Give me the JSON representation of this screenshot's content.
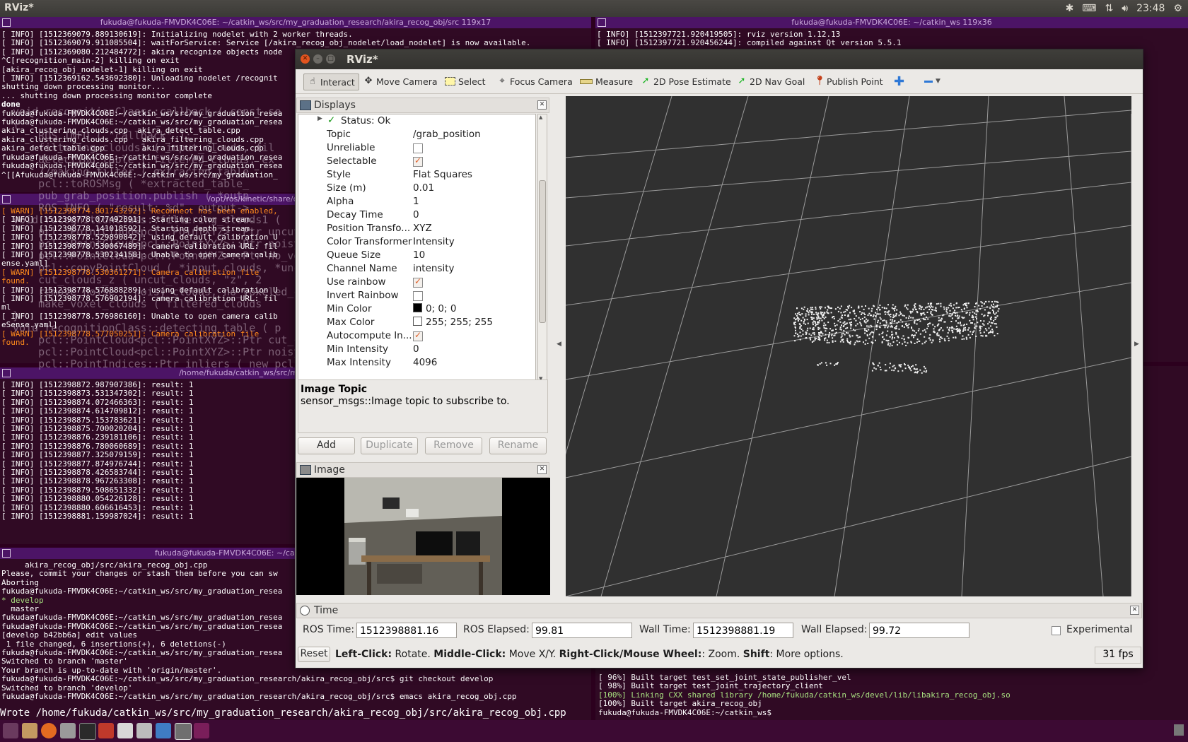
{
  "topbar": {
    "app_title": "RViz*",
    "clock": "23:48",
    "tray_icons": [
      "dropbox-icon",
      "keyboard-icon",
      "network-icon",
      "volume-icon"
    ]
  },
  "terminals": {
    "t1": {
      "title": "fukuda@fukuda-FMVDK4C06E: ~/catkin_ws/src/my_graduation_research/akira_recog_obj/src 119x17",
      "lines": [
        {
          "t": "[ INFO] [1512369079.889130619]: Initializing nodelet with 2 worker threads.",
          "c": ""
        },
        {
          "t": "[ INFO] [1512369079.911085504]: waitForService: Service [/akira_recog_obj_nodelet/load_nodelet] is now available.",
          "c": ""
        },
        {
          "t": "[ INFO] [1512369080.212484772]: akira recognize objects node",
          "c": ""
        },
        {
          "t": "^C[recognition_main-2] killing on exit",
          "c": ""
        },
        {
          "t": "[akira_recog_obj_nodelet-1] killing on exit",
          "c": ""
        },
        {
          "t": "[ INFO] [1512369162.543692380]: Unloading nodelet /recognit",
          "c": ""
        },
        {
          "t": "shutting down processing monitor...",
          "c": ""
        },
        {
          "t": "... shutting down processing monitor complete",
          "c": ""
        },
        {
          "t": "done",
          "c": "b"
        },
        {
          "t": "fukuda@fukuda-FMVDK4C06E:~/catkin_ws/src/my_graduation_resea",
          "c": ""
        },
        {
          "t": "fukuda@fukuda-FMVDK4C06E:~/catkin_ws/src/my_graduation_resea",
          "c": ""
        },
        {
          "t": "akira_clustering_clouds.cpp  akira_detect_table.cpp",
          "c": ""
        },
        {
          "t": "akira_clustering_clouds.cpp   akira_filtering_clouds.cpp",
          "c": ""
        },
        {
          "t": "akira_detect_table.cpp        akira_filtering_clouds.cpp",
          "c": ""
        },
        {
          "t": "fukuda@fukuda-FMVDK4C06E:~/catkin_ws/src/my_graduation_resea",
          "c": ""
        },
        {
          "t": "fukuda@fukuda-FMVDK4C06E:~/catkin_ws/src/my_graduation_resea",
          "c": ""
        },
        {
          "t": "^[[Afukuda@fukuda-FMVDK4C06E:~/catkin_ws/src/my_graduation_",
          "c": ""
        }
      ]
    },
    "t2": {
      "title": "fukuda@fukuda-FMVDK4C06E: ~/catkin_ws 119x36",
      "lines": [
        {
          "t": "[ INFO] [1512397721.920419505]: rviz version 1.12.13",
          "c": ""
        },
        {
          "t": "[ INFO] [1512397721.920456244]: compiled against Qt version 5.5.1",
          "c": ""
        }
      ]
    },
    "t3": {
      "title": "/opt/ros/kinetic/share/openni2_launch/launch",
      "lines": [
        {
          "t": "[ WARN] [1512398774.801743292]: Reconnect has been enabled,",
          "c": "y"
        },
        {
          "t": "[ INFO] [1512398778.077492891]: Starting color stream.",
          "c": ""
        },
        {
          "t": "[ INFO] [1512398778.141018592]: Starting depth stream.",
          "c": ""
        },
        {
          "t": "[ INFO] [1512398778.529890842]: using default calibration U",
          "c": ""
        },
        {
          "t": "[ INFO] [1512398778.530067489]: camera calibration URL: fil",
          "c": ""
        },
        {
          "t": "[ INFO] [1512398778.530234158]: Unable to open camera calib",
          "c": ""
        },
        {
          "t": "ense.yaml]",
          "c": ""
        },
        {
          "t": "[ WARN] [1512398778.530361271]: Camera calibration file",
          "c": "y"
        },
        {
          "t": "found.",
          "c": "y"
        },
        {
          "t": "[ INFO] [1512398778.576888289]: using default calibration U",
          "c": ""
        },
        {
          "t": "[ INFO] [1512398778.576902194]: camera calibration URL: fil",
          "c": ""
        },
        {
          "t": "ml",
          "c": ""
        },
        {
          "t": "[ INFO] [1512398778.576986160]: Unable to open camera calib",
          "c": ""
        },
        {
          "t": "eSense.yaml]",
          "c": ""
        },
        {
          "t": "[ WARN] [1512398778.577050251]: Camera calibration file",
          "c": "y"
        },
        {
          "t": "found.",
          "c": "y"
        }
      ]
    },
    "t4": {
      "title": "/home/fukuda/catkin_ws/src/my_graduation_research/akira_",
      "lines": [
        {
          "t": "[ INFO] [1512398872.987907386]: result: 1",
          "c": ""
        },
        {
          "t": "[ INFO] [1512398873.531347302]: result: 1",
          "c": ""
        },
        {
          "t": "[ INFO] [1512398874.072466363]: result: 1",
          "c": ""
        },
        {
          "t": "[ INFO] [1512398874.614709812]: result: 1",
          "c": ""
        },
        {
          "t": "[ INFO] [1512398875.153783621]: result: 1",
          "c": ""
        },
        {
          "t": "[ INFO] [1512398875.700020204]: result: 1",
          "c": ""
        },
        {
          "t": "[ INFO] [1512398876.239181106]: result: 1",
          "c": ""
        },
        {
          "t": "[ INFO] [1512398876.780060689]: result: 1",
          "c": ""
        },
        {
          "t": "[ INFO] [1512398877.325079159]: result: 1",
          "c": ""
        },
        {
          "t": "[ INFO] [1512398877.874976744]: result: 1",
          "c": ""
        },
        {
          "t": "[ INFO] [1512398878.426583744]: result: 1",
          "c": ""
        },
        {
          "t": "[ INFO] [1512398878.967263308]: result: 1",
          "c": ""
        },
        {
          "t": "[ INFO] [1512398879.508651332]: result: 1",
          "c": ""
        },
        {
          "t": "[ INFO] [1512398880.054226128]: result: 1",
          "c": ""
        },
        {
          "t": "[ INFO] [1512398880.606616453]: result: 1",
          "c": ""
        },
        {
          "t": "[ INFO] [1512398881.159987024]: result: 1",
          "c": ""
        }
      ]
    },
    "t5": {
      "title": "fukuda@fukuda-FMVDK4C06E: ~/catkin_ws/src/my_graduation_research",
      "lines": [
        {
          "t": "     akira_recog_obj/src/akira_recog_obj.cpp",
          "c": ""
        },
        {
          "t": "Please, commit your changes or stash them before you can sw",
          "c": ""
        },
        {
          "t": "Aborting",
          "c": ""
        },
        {
          "t": "fukuda@fukuda-FMVDK4C06E:~/catkin_ws/src/my_graduation_resea",
          "c": ""
        },
        {
          "t": "* develop",
          "c": "g"
        },
        {
          "t": "  master",
          "c": ""
        },
        {
          "t": "fukuda@fukuda-FMVDK4C06E:~/catkin_ws/src/my_graduation_resea",
          "c": ""
        },
        {
          "t": "fukuda@fukuda-FMVDK4C06E:~/catkin_ws/src/my_graduation_resea",
          "c": ""
        },
        {
          "t": "[develop b42bb6a] edit values",
          "c": ""
        },
        {
          "t": " 1 file changed, 6 insertions(+), 6 deletions(-)",
          "c": ""
        },
        {
          "t": "fukuda@fukuda-FMVDK4C06E:~/catkin_ws/src/my_graduation_resea",
          "c": ""
        },
        {
          "t": "Switched to branch 'master'",
          "c": ""
        },
        {
          "t": "Your branch is up-to-date with 'origin/master'.",
          "c": ""
        },
        {
          "t": "fukuda@fukuda-FMVDK4C06E:~/catkin_ws/src/my_graduation_research/akira_recog_obj/src$ git checkout develop",
          "c": ""
        },
        {
          "t": "Switched to branch 'develop'",
          "c": ""
        },
        {
          "t": "fukuda@fukuda-FMVDK4C06E:~/catkin_ws/src/my_graduation_research/akira_recog_obj/src$ emacs akira_recog_obj.cpp",
          "c": ""
        }
      ]
    },
    "t6": {
      "lines": [
        {
          "t": "[ 96%] Built target test_set_joint_state_publisher_vel",
          "c": ""
        },
        {
          "t": "[ 98%] Built target test_joint_trajectory_client",
          "c": ""
        },
        {
          "t": "[100%] Linking CXX shared library /home/fukuda/catkin_ws/devel/lib/libakira_recog_obj.so",
          "c": "g"
        },
        {
          "t": "[100%] Built target akira_recog_obj",
          "c": ""
        },
        {
          "t": "fukuda@fukuda-FMVDK4C06E:~/catkin_ws$ ",
          "c": ""
        }
      ]
    },
    "emacs_status": "Wrote /home/fukuda/catkin_ws/src/my_graduation_research/akira_recog_obj/src/akira_recog_obj.cpp",
    "ghost_code": [
      "  void recognitionClass::callback ( const se",
      "  {",
      "      ROS_INFO ( \"callback\" );",
      "      filtering_clouds1 ( input_clouds, fil",
      "      detecting_table ( filtered_clouds, ex",
      "      //making filter ( extracted_table",
      "      pcl::toROSMsg ( *extracted_table_",
      "      pub_grab_position.publish ( *outp",
      "      ROS_INFO ( \"result: %d\", output->",
      "  void recognitionClass::filtering_clouds1 (",
      "      pcl::PointCloud<pcl::PointXYZ>::Ptr uncut",
      "      pcl::PointCloud<pcl::PointXYZ>::Ptr noisy",
      "      pcl::PointCloud<pcl::PointXYZ>::Ptr no_vo",
      "      pcl::copyPointCloud ( *input_clouds, *uncut_c",
      "      cut_clouds_z ( uncut_clouds, \"z\", 2",
      "      remove_noise ( noisy_clouds, no_voxeled_c",
      "      make_voxel_clouds ( filtered_clouds",
      "  }",
      "  void recognitionClass::detecting_table ( p",
      "      pcl::PointCloud<pcl::PointXYZ>::Ptr cut_c",
      "      pcl::PointCloud<pcl::PointXYZ>::Ptr noisy",
      "      pcl::PointIndices::Ptr inliers ( new pcl::PointIndices );"
    ]
  },
  "rviz": {
    "window_title": "RViz*",
    "toolbar": [
      {
        "id": "interact",
        "label": "Interact",
        "icon": "hand-pointer-icon",
        "active": true
      },
      {
        "id": "move-camera",
        "label": "Move Camera",
        "icon": "move-camera-icon"
      },
      {
        "id": "select",
        "label": "Select",
        "icon": "select-box-icon"
      },
      {
        "id": "focus-camera",
        "label": "Focus Camera",
        "icon": "focus-target-icon"
      },
      {
        "id": "measure",
        "label": "Measure",
        "icon": "ruler-icon"
      },
      {
        "id": "2d-pose",
        "label": "2D Pose Estimate",
        "icon": "green-arrow-icon"
      },
      {
        "id": "2d-nav",
        "label": "2D Nav Goal",
        "icon": "green-arrow-icon"
      },
      {
        "id": "publish-point",
        "label": "Publish Point",
        "icon": "map-pin-icon"
      }
    ],
    "displays": {
      "title": "Displays",
      "status": "Status: Ok",
      "properties": [
        {
          "key": "Topic",
          "value": "/grab_position",
          "type": "text"
        },
        {
          "key": "Unreliable",
          "value": false,
          "type": "check"
        },
        {
          "key": "Selectable",
          "value": true,
          "type": "check"
        },
        {
          "key": "Style",
          "value": "Flat Squares",
          "type": "text"
        },
        {
          "key": "Size (m)",
          "value": "0.01",
          "type": "text"
        },
        {
          "key": "Alpha",
          "value": "1",
          "type": "text"
        },
        {
          "key": "Decay Time",
          "value": "0",
          "type": "text"
        },
        {
          "key": "Position Transfo...",
          "value": "XYZ",
          "type": "text"
        },
        {
          "key": "Color Transformer",
          "value": "Intensity",
          "type": "text"
        },
        {
          "key": "Queue Size",
          "value": "10",
          "type": "text"
        },
        {
          "key": "Channel Name",
          "value": "intensity",
          "type": "text"
        },
        {
          "key": "Use rainbow",
          "value": true,
          "type": "check"
        },
        {
          "key": "Invert Rainbow",
          "value": false,
          "type": "check"
        },
        {
          "key": "Min Color",
          "value": "0; 0; 0",
          "type": "color",
          "swatch": "#000000"
        },
        {
          "key": "Max Color",
          "value": "255; 255; 255",
          "type": "color",
          "swatch": "#ffffff"
        },
        {
          "key": "Autocompute In...",
          "value": true,
          "type": "check"
        },
        {
          "key": "Min Intensity",
          "value": "0",
          "type": "text"
        },
        {
          "key": "Max Intensity",
          "value": "4096",
          "type": "text"
        }
      ],
      "desc_title": "Image Topic",
      "desc_text": "sensor_msgs::Image topic to subscribe to.",
      "buttons": {
        "add": "Add",
        "duplicate": "Duplicate",
        "remove": "Remove",
        "rename": "Rename"
      }
    },
    "image_panel": {
      "title": "Image"
    },
    "time_panel": {
      "title": "Time",
      "ros_time_label": "ROS Time:",
      "ros_time": "1512398881.16",
      "ros_elapsed_label": "ROS Elapsed:",
      "ros_elapsed": "99.81",
      "wall_time_label": "Wall Time:",
      "wall_time": "1512398881.19",
      "wall_elapsed_label": "Wall Elapsed:",
      "wall_elapsed": "99.72",
      "experimental_label": "Experimental"
    },
    "status_bar": {
      "reset": "Reset",
      "left_click": "Left-Click:",
      "rotate": " Rotate. ",
      "middle_click": "Middle-Click:",
      "move": " Move X/Y. ",
      "right_click": "Right-Click/Mouse Wheel:",
      "zoom": ": Zoom. ",
      "shift": "Shift",
      "more": ": More options.",
      "fps": "31 fps"
    }
  },
  "launcher": {
    "items": [
      "dash-icon",
      "files-icon",
      "firefox-icon",
      "settings-icon",
      "terminal-icon",
      "impress-icon",
      "camera-app-icon",
      "image-viewer-icon",
      "qt-creator-icon",
      "rviz-icon",
      "terminal-2-icon"
    ]
  }
}
